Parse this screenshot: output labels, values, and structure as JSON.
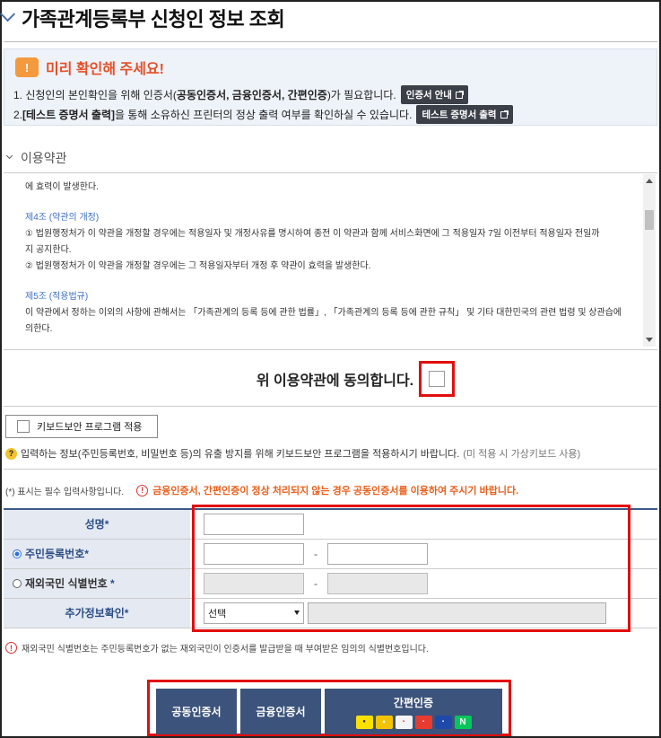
{
  "page": {
    "title": "가족관계등록부 신청인 정보 조회"
  },
  "notice": {
    "heading": "미리 확인해 주세요!",
    "line1_prefix": "1. 신청인의 본인확인을 위해 인증서(",
    "line1_bold": "공동인증서, 금융인증서, 간편인증",
    "line1_suffix": ")가 필요합니다.",
    "line1_button": "인증서 안내",
    "line2_bold": "[테스트 증명서 출력]",
    "line2_prefix": "2. ",
    "line2_suffix": "을 통해 소유하신 프린터의 정상 출력 여부를 확인하실 수 있습니다.",
    "line2_button": "테스트 증명서 출력"
  },
  "terms": {
    "section_title": "이용약관",
    "lines": [
      "에 효력이 발생한다.",
      "제4조 (약관의 개정)",
      "① 법원행정처가 이 약관을 개정할 경우에는 적용일자 및 개정사유를 명시하여 종전 이 약관과 함께 서비스화면에 그 적용일자 7일 이전부터 적용일자 전일까",
      "지 공지한다.",
      "② 법원행정처가 이 약관을 개정할 경우에는 그 적용일자부터 개정 후 약관이 효력을 발생한다.",
      "제5조 (적용법규)",
      "이 약관에서 정하는 이외의 사항에 관해서는 「가족관계의 등록 등에 관한 법률」, 「가족관계의 등록 등에 관한 규칙」 및 기타 대한민국의 관련 법령 및 상관습에",
      "의한다."
    ]
  },
  "agree": {
    "label": "위 이용약관에 동의합니다."
  },
  "keyboard": {
    "button_label": "키보드보안 프로그램 적용",
    "info_text": "입력하는 정보(주민등록번호, 비밀번호 등)의 유출 방지를 위해 키보드보안 프로그램을 적용하시기 바랍니다.",
    "info_gray": "(미 적용 시 가상키보드 사용)"
  },
  "required_note": "(*) 표시는 필수 입력사항입니다.",
  "warning": "금융인증서, 간편인증이 정상 처리되지 않는 경우 공동인증서를 이용하여 주시기 바랍니다.",
  "form": {
    "name_label": "성명",
    "rrn_label": "주민등록번호",
    "foreign_label": "재외국민 식별번호",
    "extra_label": "추가정보확인",
    "star": "*",
    "dash": "-",
    "select_value": "선택"
  },
  "foot_note": "재외국민 식별번호는 주민등록번호가 없는 재외국민이 인증서를 발급받을 때 부여받은 임의의 식별번호입니다.",
  "buttons": {
    "joint_cert": "공동인증서",
    "financial_cert": "금융인증서",
    "easy_auth": "간편인증",
    "easy_logos": [
      "kakao-icon",
      "toss-icon",
      "payco-icon",
      "pass-icon",
      "samsung-pass-icon",
      "naver-icon"
    ]
  },
  "colors": {
    "accent_red": "#e20d0d",
    "button_navy": "#3c537b",
    "label_bg": "#e4e9f2",
    "warning_orange": "#e8601c"
  }
}
